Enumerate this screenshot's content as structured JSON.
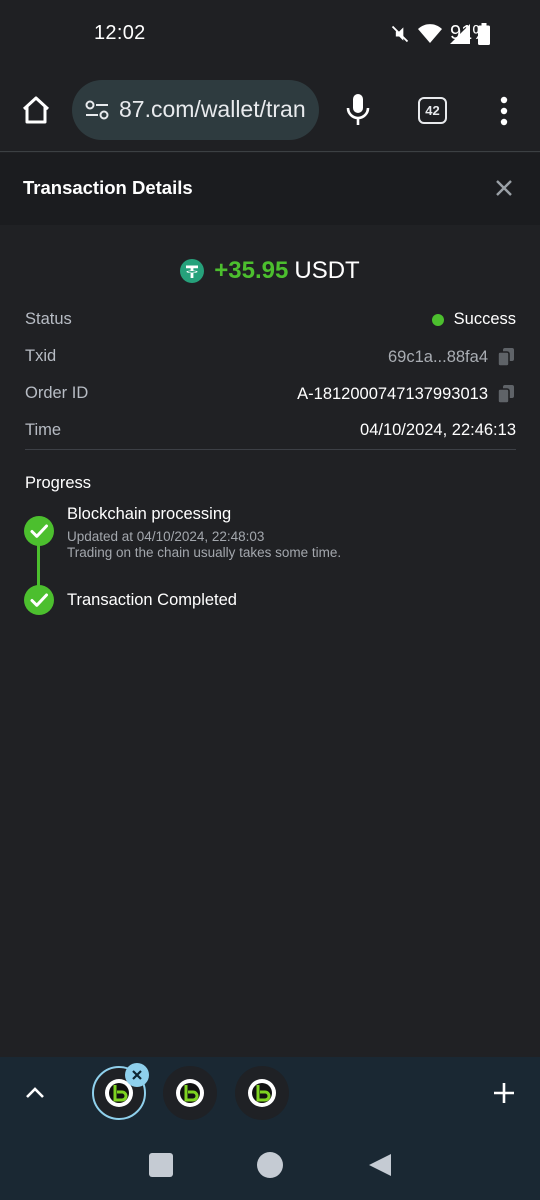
{
  "status_bar": {
    "time": "12:02",
    "battery": "91%",
    "icons": [
      "mute-icon",
      "wifi-icon",
      "signal-icon",
      "battery-icon"
    ]
  },
  "browser": {
    "url": "87.com/wallet/tran",
    "tab_count": "42",
    "icons": [
      "home-icon",
      "site-settings-icon",
      "mic-icon",
      "tab-switcher-icon",
      "more-menu-icon"
    ]
  },
  "dialog": {
    "title": "Transaction Details",
    "amount": "+35.95",
    "currency": "USDT",
    "details": [
      {
        "label": "Status",
        "value": "Success"
      },
      {
        "label": "Txid",
        "value": "69c1a...88fa4"
      },
      {
        "label": "Order ID",
        "value": "A-1812000747137993013"
      },
      {
        "label": "Time",
        "value": "04/10/2024, 22:46:13"
      }
    ],
    "progress": {
      "heading": "Progress",
      "steps": [
        {
          "title": "Blockchain processing",
          "updated": "Updated at 04/10/2024, 22:48:03",
          "note": "Trading on the chain usually takes some time."
        },
        {
          "title": "Transaction Completed"
        }
      ]
    }
  },
  "colors": {
    "accent_green": "#4cbf2e",
    "tether": "#26a17b",
    "tab_accent": "#8fd0ec"
  }
}
